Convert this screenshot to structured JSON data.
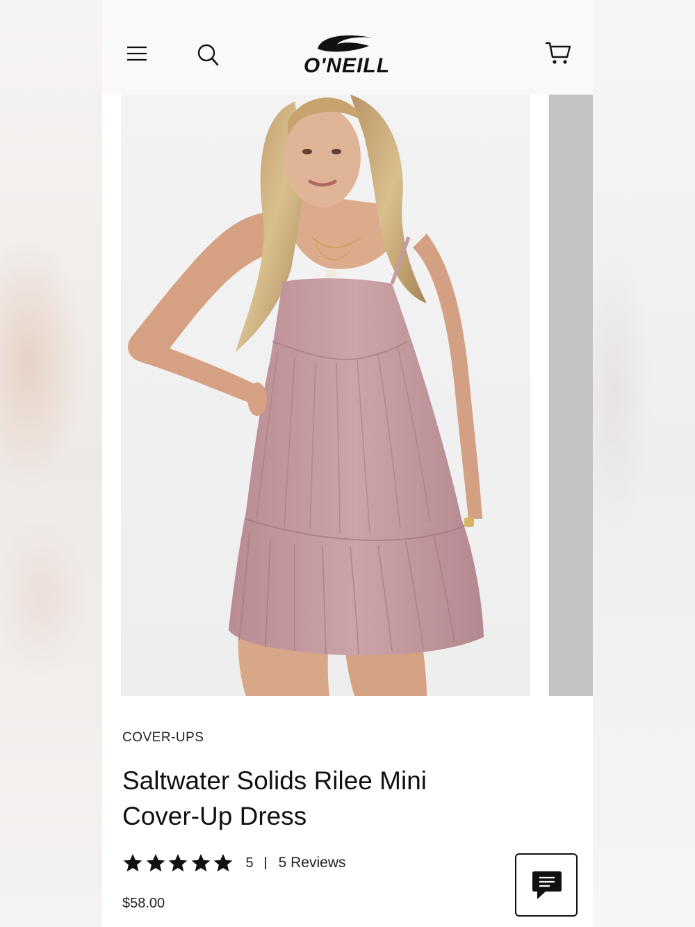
{
  "header": {
    "brand": "O'NEILL",
    "menu_icon": "hamburger-menu-icon",
    "search_icon": "search-icon",
    "cart_icon": "shopping-cart-icon"
  },
  "gallery": {
    "current_image": "woman wearing pink tiered mini cover-up dress",
    "next_image_peek": true
  },
  "product": {
    "category": "COVER-UPS",
    "title": "Saltwater Solids Rilee Mini Cover-Up Dress",
    "rating": {
      "stars": 5,
      "max": 5,
      "value": "5",
      "reviews": "5 Reviews"
    },
    "price": "$58.00"
  },
  "chat": {
    "icon": "chat-bubble-icon"
  },
  "colors": {
    "text": "#111111",
    "header_bg": "#f9f9fa",
    "dress": "#c39a9f"
  }
}
